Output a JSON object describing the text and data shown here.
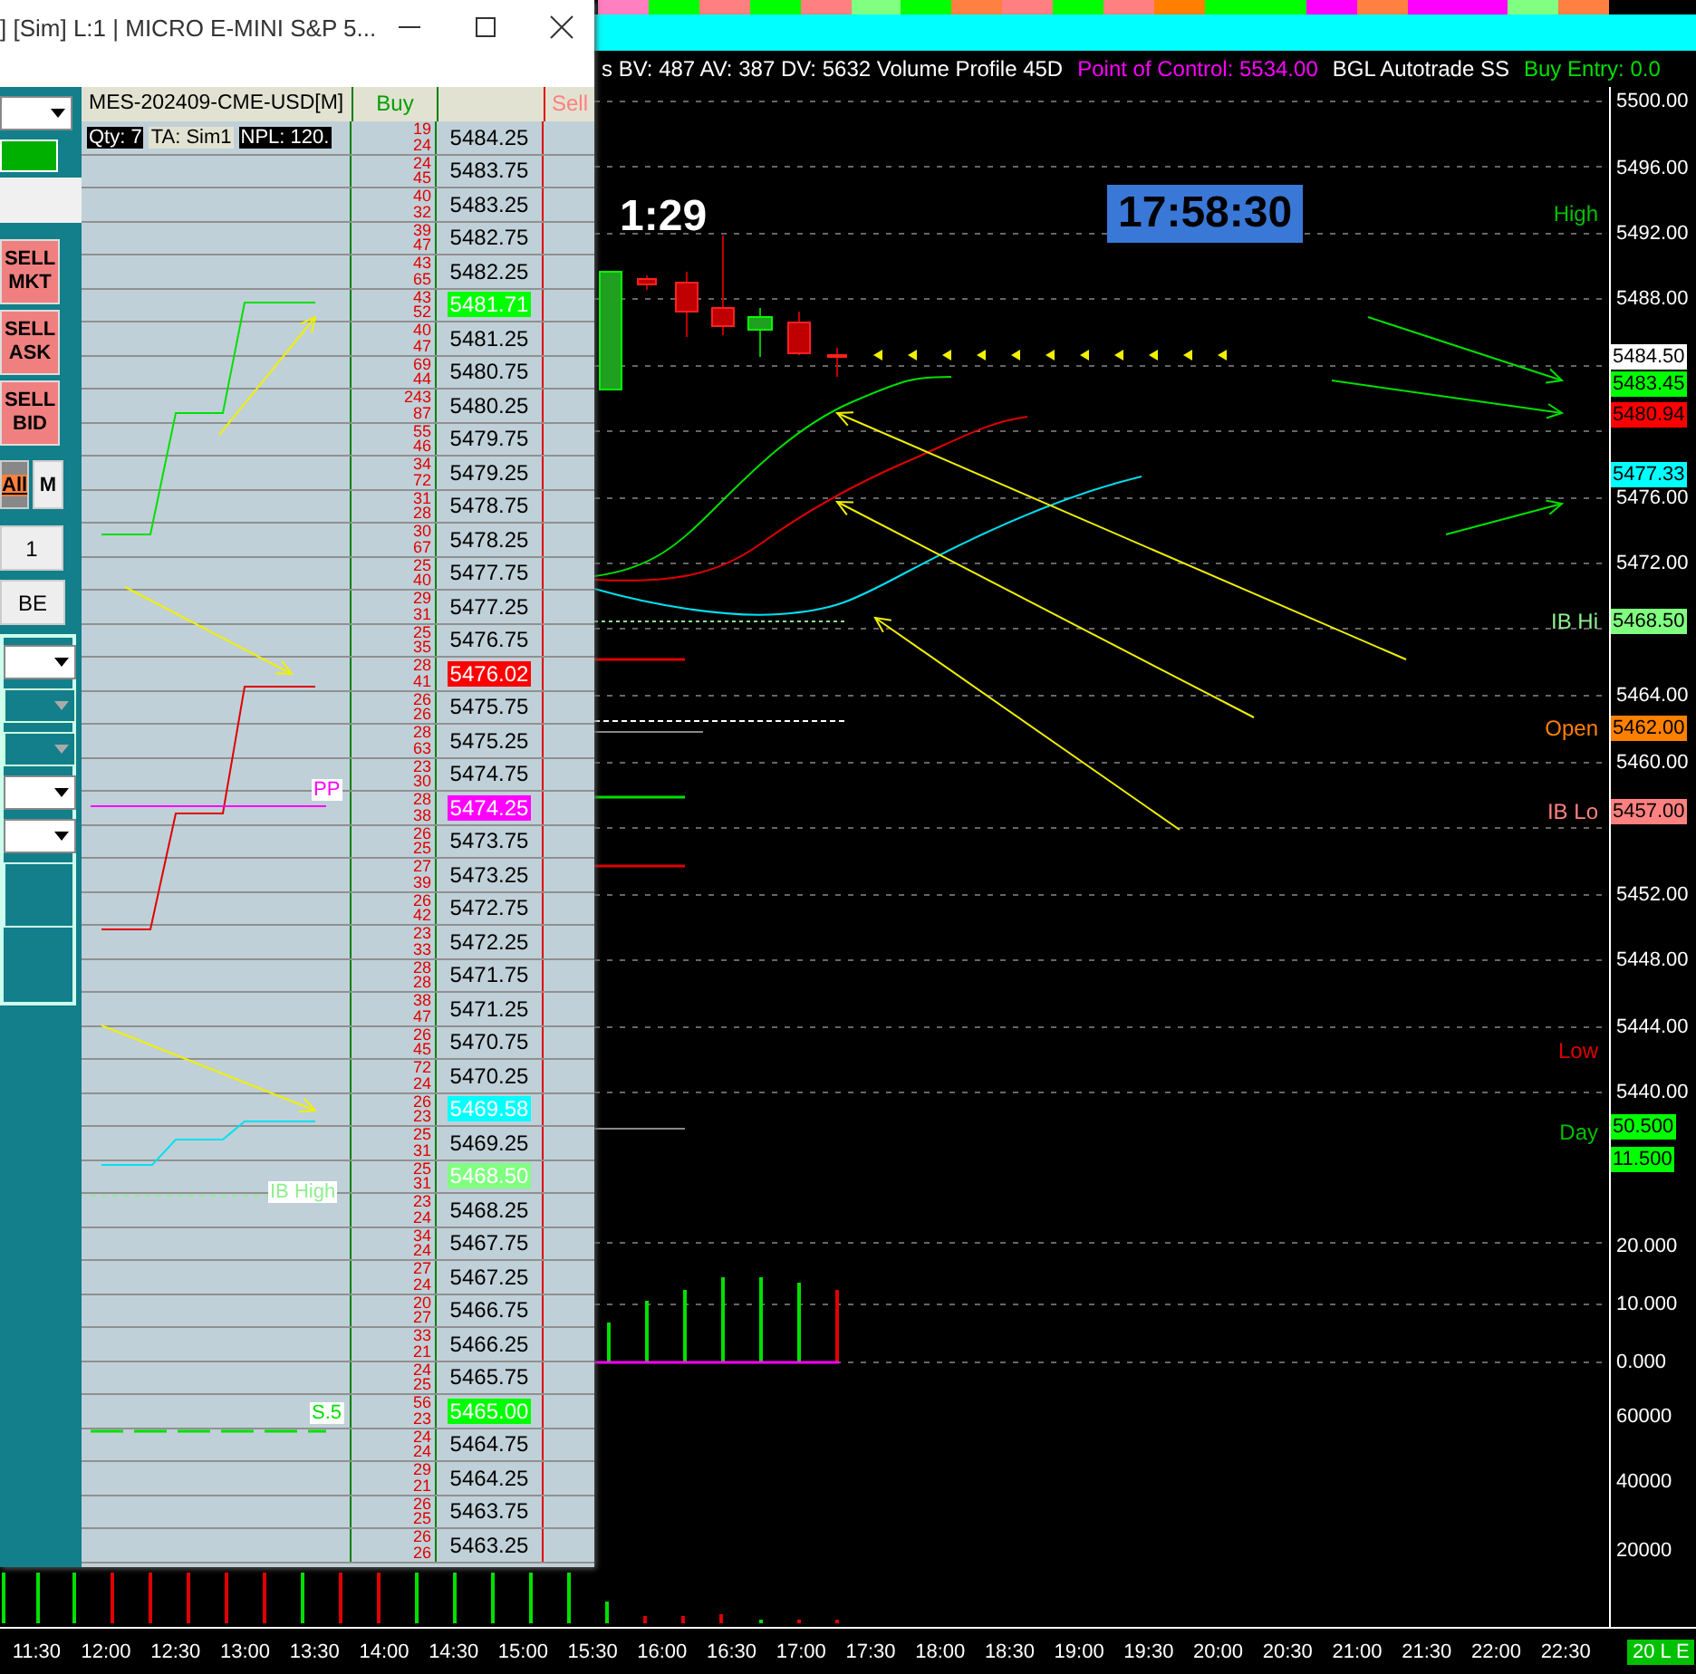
{
  "top_strip": [
    {
      "color": "#ff80c0"
    },
    {
      "color": "#00ff00"
    },
    {
      "color": "#ff8080"
    },
    {
      "color": "#00ff00"
    },
    {
      "color": "#ff8080"
    },
    {
      "color": "#80ff80"
    },
    {
      "color": "#00ff00"
    },
    {
      "color": "#ff8040"
    },
    {
      "color": "#ff8080"
    },
    {
      "color": "#00ff00"
    },
    {
      "color": "#ff8080"
    },
    {
      "color": "#ff8000"
    },
    {
      "color": "#00ff00"
    },
    {
      "color": "#00ff00"
    },
    {
      "color": "#ff00ff"
    },
    {
      "color": "#ff8040"
    },
    {
      "color": "#ff00ff"
    },
    {
      "color": "#ff00ff"
    },
    {
      "color": "#80ff80"
    },
    {
      "color": "#ff8040"
    }
  ],
  "info_bar": [
    {
      "text": "s BV: 487 AV: 387 DV: 5632 Volume Profile 45D",
      "color": "#ffffff"
    },
    {
      "text": "Point of Control: 5534.00",
      "color": "#ff00ff"
    },
    {
      "text": "BGL Autotrade SS",
      "color": "#ffffff"
    },
    {
      "text": "Buy Entry: 0.0",
      "color": "#00e000"
    }
  ],
  "chart": {
    "bar_timer": "1:29",
    "clock": "17:58:30",
    "level_labels": [
      {
        "label": "High",
        "color": "#00c000"
      },
      {
        "label": "IB Hi",
        "color": "#90ee90"
      },
      {
        "label": "Open",
        "color": "#ff8000"
      },
      {
        "label": "IB Lo",
        "color": "#ff8080"
      },
      {
        "label": "Low",
        "color": "#e00000"
      },
      {
        "label": "Day",
        "color": "#00c000"
      }
    ]
  },
  "price_axis": {
    "ticks": [
      "5500.00",
      "5496.00",
      "5492.00",
      "5488.00",
      "5476.00",
      "5472.00",
      "5464.00",
      "5460.00",
      "5452.00",
      "5448.00",
      "5444.00",
      "5440.00"
    ],
    "badges": [
      {
        "text": "5484.50",
        "color": "#ffffff"
      },
      {
        "text": "5483.45",
        "color": "#00ff00"
      },
      {
        "text": "5480.94",
        "color": "#ff0000"
      },
      {
        "text": "5477.33",
        "color": "#00ffff"
      },
      {
        "text": "5468.50",
        "color": "#80ff80"
      },
      {
        "text": "5462.00",
        "color": "#ff8000"
      },
      {
        "text": "5457.00",
        "color": "#ff8080"
      }
    ],
    "lower": [
      {
        "text": "50.500",
        "kind": "badge",
        "color": "#00ff00"
      },
      {
        "text": "11.500",
        "kind": "badge",
        "color": "#00ff00"
      },
      {
        "text": "20.000",
        "kind": "tick"
      },
      {
        "text": "10.000",
        "kind": "tick"
      },
      {
        "text": "0.000",
        "kind": "tick"
      },
      {
        "text": "60000",
        "kind": "tick"
      },
      {
        "text": "40000",
        "kind": "tick"
      },
      {
        "text": "20000",
        "kind": "tick"
      }
    ]
  },
  "time_axis": {
    "labels": [
      "11:30",
      "12:00",
      "12:30",
      "13:00",
      "13:30",
      "14:00",
      "14:30",
      "15:00",
      "15:30",
      "16:00",
      "16:30",
      "17:00",
      "17:30",
      "18:00",
      "18:30",
      "19:00",
      "19:30",
      "20:00",
      "20:30",
      "21:00",
      "21:30",
      "22:00",
      "22:30"
    ],
    "badge": "20 L E"
  },
  "window": {
    "title": "] [Sim]  L:1 | MICRO E-MINI S&P 5...",
    "panel": {
      "sell_buttons": [
        "SELL MKT",
        "SELL ASK",
        "SELL BID"
      ],
      "all_button": "All",
      "m_button": "M",
      "quantity": "1",
      "be_button": "BE",
      "dropdowns": [
        {
          "disabled": false
        },
        {
          "disabled": true
        },
        {
          "disabled": true
        },
        {
          "disabled": false
        },
        {
          "disabled": false
        }
      ]
    },
    "symbol": "MES-202409-CME-USD[M]",
    "stats": [
      "Qty: 7",
      "TA: Sim1",
      "NPL: 120."
    ],
    "ladder": {
      "buy_header": "Buy",
      "sell_header": "Sell",
      "rows": [
        {
          "price": "5484.25",
          "volumes": [
            "19",
            "24"
          ]
        },
        {
          "price": "5483.75",
          "volumes": [
            "24",
            "45"
          ]
        },
        {
          "price": "5483.25",
          "volumes": [
            "40",
            "32"
          ]
        },
        {
          "price": "5482.75",
          "volumes": [
            "39",
            "47"
          ]
        },
        {
          "price": "5482.25",
          "volumes": [
            "43",
            "65"
          ]
        },
        {
          "price": "5481.71",
          "color": "#00ff00",
          "volumes": [
            "43",
            "52"
          ]
        },
        {
          "price": "5481.25",
          "volumes": [
            "40",
            "47"
          ]
        },
        {
          "price": "5480.75",
          "volumes": [
            "69",
            "44"
          ]
        },
        {
          "price": "5480.25",
          "volumes": [
            "243",
            "87"
          ]
        },
        {
          "price": "5479.75",
          "volumes": [
            "55",
            "46"
          ]
        },
        {
          "price": "5479.25",
          "volumes": [
            "34",
            "72"
          ]
        },
        {
          "price": "5478.75",
          "volumes": [
            "31",
            "28"
          ]
        },
        {
          "price": "5478.25",
          "volumes": [
            "30",
            "67"
          ]
        },
        {
          "price": "5477.75",
          "volumes": [
            "25",
            "40"
          ]
        },
        {
          "price": "5477.25",
          "volumes": [
            "29",
            "31"
          ]
        },
        {
          "price": "5476.75",
          "volumes": [
            "25",
            "35"
          ]
        },
        {
          "price": "5476.02",
          "color": "#ff0000",
          "volumes": [
            "28",
            "41"
          ]
        },
        {
          "price": "5475.75",
          "volumes": [
            "26",
            "26"
          ]
        },
        {
          "price": "5475.25",
          "volumes": [
            "28",
            "63"
          ]
        },
        {
          "price": "5474.75",
          "volumes": [
            "23",
            "30"
          ]
        },
        {
          "price": "5474.25",
          "color": "#ff00ff",
          "volumes": [
            "28",
            "38"
          ]
        },
        {
          "price": "5473.75",
          "volumes": [
            "26",
            "25"
          ]
        },
        {
          "price": "5473.25",
          "volumes": [
            "27",
            "39"
          ]
        },
        {
          "price": "5472.75",
          "volumes": [
            "26",
            "42"
          ]
        },
        {
          "price": "5472.25",
          "volumes": [
            "23",
            "33"
          ]
        },
        {
          "price": "5471.75",
          "volumes": [
            "28",
            "28"
          ]
        },
        {
          "price": "5471.25",
          "volumes": [
            "38",
            "47"
          ]
        },
        {
          "price": "5470.75",
          "volumes": [
            "26",
            "45"
          ]
        },
        {
          "price": "5470.25",
          "volumes": [
            "72",
            "24"
          ]
        },
        {
          "price": "5469.58",
          "color": "#00ffff",
          "volumes": [
            "26",
            "23"
          ]
        },
        {
          "price": "5469.25",
          "volumes": [
            "25",
            "31"
          ]
        },
        {
          "price": "5468.50",
          "color": "#80ff80",
          "volumes": [
            "25",
            "31"
          ]
        },
        {
          "price": "5468.25",
          "volumes": [
            "23",
            "24"
          ]
        },
        {
          "price": "5467.75",
          "volumes": [
            "34",
            "24"
          ]
        },
        {
          "price": "5467.25",
          "volumes": [
            "27",
            "24"
          ]
        },
        {
          "price": "5466.75",
          "volumes": [
            "20",
            "27"
          ]
        },
        {
          "price": "5466.25",
          "volumes": [
            "33",
            "21"
          ]
        },
        {
          "price": "5465.75",
          "volumes": [
            "24",
            "25"
          ]
        },
        {
          "price": "5465.00",
          "color": "#00ff00",
          "volumes": [
            "56",
            "23"
          ]
        },
        {
          "price": "5464.75",
          "volumes": [
            "24",
            "24"
          ]
        },
        {
          "price": "5464.25",
          "volumes": [
            "29",
            "21"
          ]
        },
        {
          "price": "5463.75",
          "volumes": [
            "26",
            "25"
          ]
        },
        {
          "price": "5463.25",
          "volumes": [
            "26",
            "26"
          ]
        }
      ]
    },
    "mini_labels": [
      {
        "text": "PP",
        "color": "#ff00ff"
      },
      {
        "text": "IB High",
        "color": "#90ee90"
      },
      {
        "text": "S.5",
        "color": "#00e000"
      }
    ]
  }
}
